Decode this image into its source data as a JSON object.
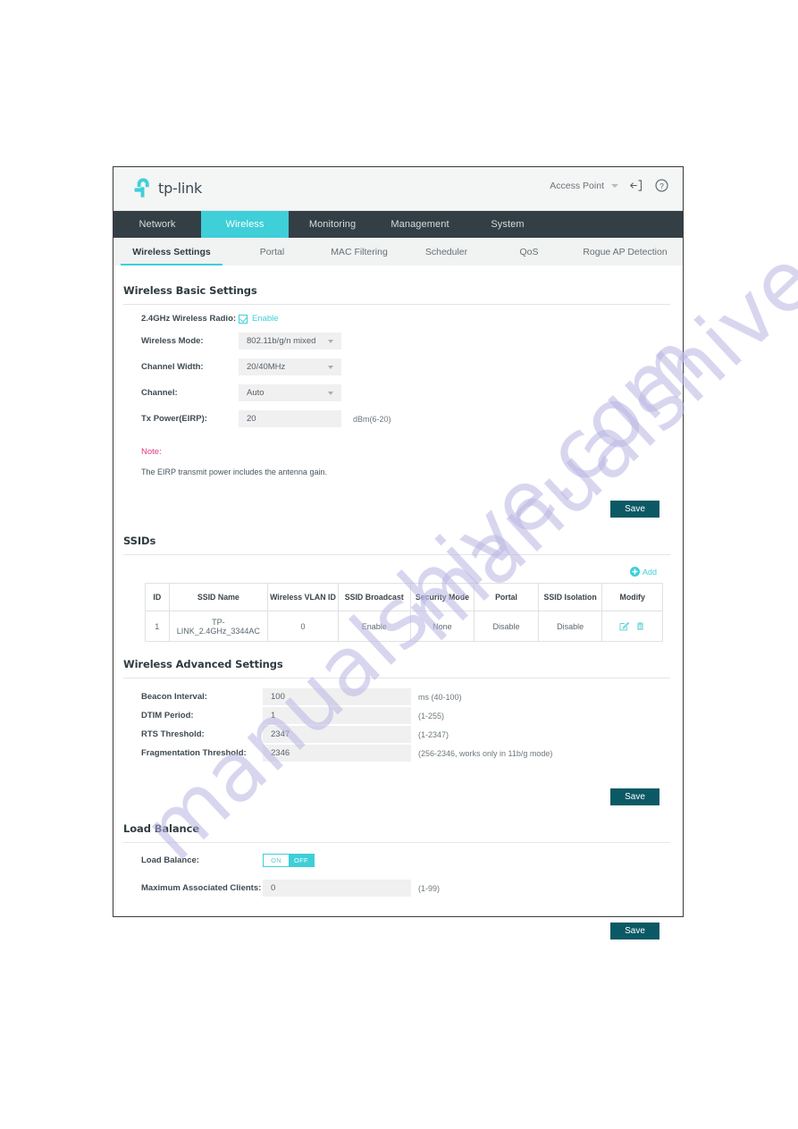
{
  "header": {
    "brand": "tp-link",
    "mode_label": "Access Point",
    "logout_icon": "logout-icon",
    "help_icon": "help-icon"
  },
  "main_nav": [
    {
      "label": "Network",
      "active": false
    },
    {
      "label": "Wireless",
      "active": true
    },
    {
      "label": "Monitoring",
      "active": false
    },
    {
      "label": "Management",
      "active": false
    },
    {
      "label": "System",
      "active": false
    }
  ],
  "sub_nav": [
    {
      "label": "Wireless Settings",
      "active": true
    },
    {
      "label": "Portal",
      "active": false
    },
    {
      "label": "MAC Filtering",
      "active": false
    },
    {
      "label": "Scheduler",
      "active": false
    },
    {
      "label": "QoS",
      "active": false
    },
    {
      "label": "Rogue AP Detection",
      "active": false
    }
  ],
  "basic": {
    "title": "Wireless Basic Settings",
    "radio": {
      "label": "2.4GHz Wireless Radio:",
      "checkbox_label": "Enable",
      "checked": true
    },
    "wireless_mode": {
      "label": "Wireless Mode:",
      "value": "802.11b/g/n mixed"
    },
    "channel_width": {
      "label": "Channel Width:",
      "value": "20/40MHz"
    },
    "channel": {
      "label": "Channel:",
      "value": "Auto"
    },
    "tx_power": {
      "label": "Tx Power(EIRP):",
      "value": "20",
      "hint": "dBm(6-20)"
    },
    "note_title": "Note:",
    "note_body": "The EIRP transmit power includes the antenna gain.",
    "save_label": "Save"
  },
  "ssids": {
    "title": "SSIDs",
    "add_label": "Add",
    "columns": [
      "ID",
      "SSID Name",
      "Wireless VLAN ID",
      "SSID Broadcast",
      "Security Mode",
      "Portal",
      "SSID Isolation",
      "Modify"
    ],
    "rows": [
      {
        "id": "1",
        "ssid_name": "TP-LINK_2.4GHz_3344AC",
        "wireless_vlan_id": "0",
        "ssid_broadcast": "Enable",
        "security_mode": "None",
        "portal": "Disable",
        "ssid_isolation": "Disable"
      }
    ]
  },
  "advanced": {
    "title": "Wireless Advanced Settings",
    "beacon_interval": {
      "label": "Beacon Interval:",
      "value": "100",
      "hint": "ms (40-100)"
    },
    "dtim_period": {
      "label": "DTIM Period:",
      "value": "1",
      "hint": "(1-255)"
    },
    "rts_threshold": {
      "label": "RTS Threshold:",
      "value": "2347",
      "hint": "(1-2347)"
    },
    "fragmentation_threshold": {
      "label": "Fragmentation Threshold:",
      "value": "2346",
      "hint": "(256-2346, works only in 11b/g mode)"
    },
    "save_label": "Save"
  },
  "load_balance": {
    "title": "Load Balance",
    "toggle": {
      "label": "Load Balance:",
      "on_label": "ON",
      "off_label": "OFF",
      "selected": "OFF"
    },
    "max_clients": {
      "label": "Maximum Associated Clients:",
      "value": "0",
      "hint": "(1-99)"
    },
    "save_label": "Save"
  },
  "watermark": {
    "line1": "manualshive.com",
    "line2": "manualshive.com"
  },
  "colors": {
    "accent_teal": "#3ecfd8",
    "nav_dark": "#343f45",
    "save_button": "#0b5964",
    "note_pink": "#e4397c"
  }
}
